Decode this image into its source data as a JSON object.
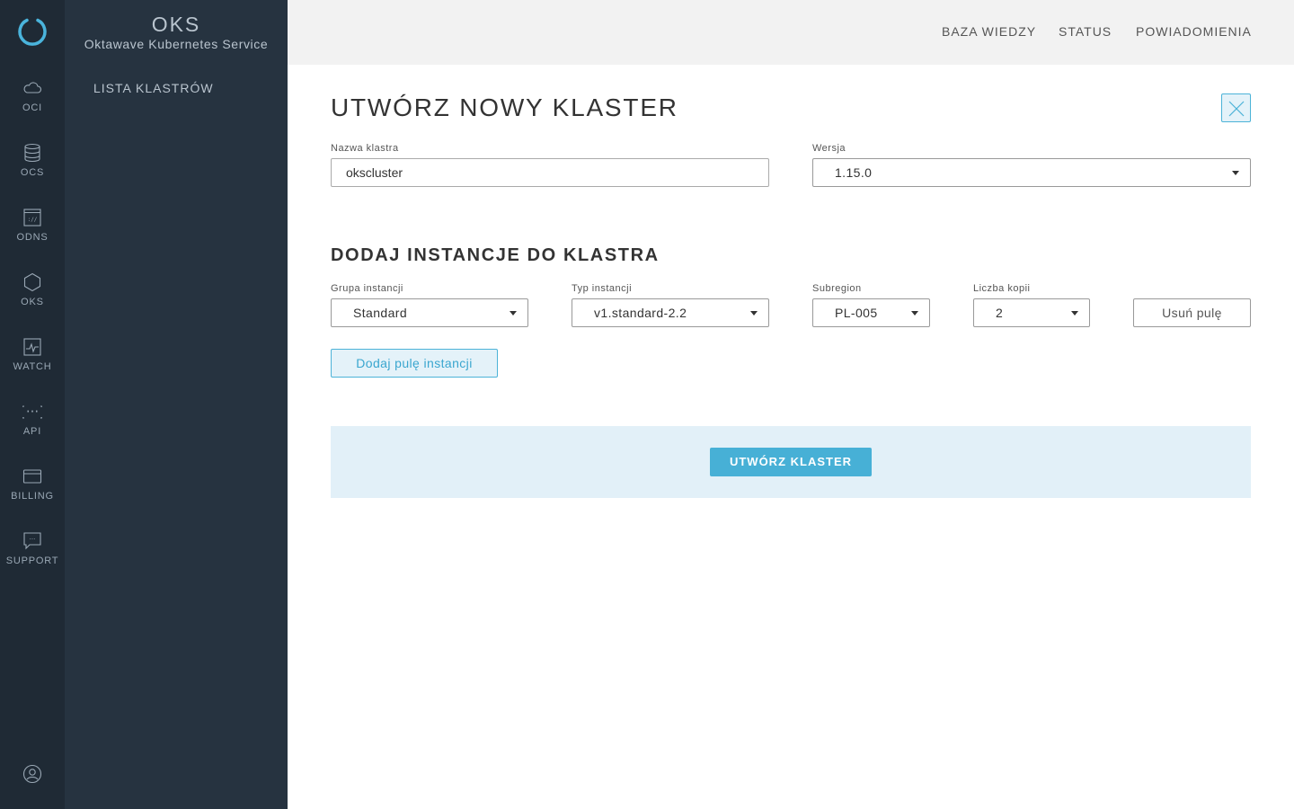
{
  "colors": {
    "rail_bg": "#1f2a35",
    "sidebar_bg": "#263340",
    "accent": "#47b0d6",
    "topbar_bg": "#f2f2f2",
    "panel_bg": "#e2f0f8"
  },
  "rail": {
    "logo_icon": "oktawave-ring-logo",
    "items": [
      {
        "label": "OCI",
        "icon": "cloud-icon"
      },
      {
        "label": "OCS",
        "icon": "database-icon"
      },
      {
        "label": "ODNS",
        "icon": "dns-icon"
      },
      {
        "label": "OKS",
        "icon": "hexagon-icon"
      },
      {
        "label": "WATCH",
        "icon": "monitor-pulse-icon"
      },
      {
        "label": "API",
        "icon": "braces-icon"
      },
      {
        "label": "BILLING",
        "icon": "credit-card-icon"
      },
      {
        "label": "SUPPORT",
        "icon": "chat-bubble-icon"
      }
    ],
    "user_icon": "user-icon"
  },
  "sidebar": {
    "title": "OKS",
    "subtitle": "Oktawave Kubernetes Service",
    "nav": [
      {
        "label": "LISTA KLASTRÓW"
      }
    ]
  },
  "topbar": {
    "links": [
      {
        "label": "BAZA WIEDZY"
      },
      {
        "label": "STATUS"
      },
      {
        "label": "POWIADOMIENIA"
      }
    ]
  },
  "main": {
    "title": "UTWÓRZ NOWY KLASTER",
    "close_icon": "close-icon",
    "cluster_name": {
      "label": "Nazwa klastra",
      "value": "okscluster"
    },
    "version": {
      "label": "Wersja",
      "value": "1.15.0"
    },
    "instances_section": {
      "title": "DODAJ INSTANCJE DO KLASTRA",
      "instance_group": {
        "label": "Grupa instancji",
        "value": "Standard"
      },
      "instance_type": {
        "label": "Typ instancji",
        "value": "v1.standard-2.2"
      },
      "subregion": {
        "label": "Subregion",
        "value": "PL-005"
      },
      "replicas": {
        "label": "Liczba kopii",
        "value": "2"
      },
      "remove_pool_label": "Usuń pulę",
      "add_pool_label": "Dodaj pulę instancji"
    },
    "create_button_label": "UTWÓRZ KLASTER"
  }
}
